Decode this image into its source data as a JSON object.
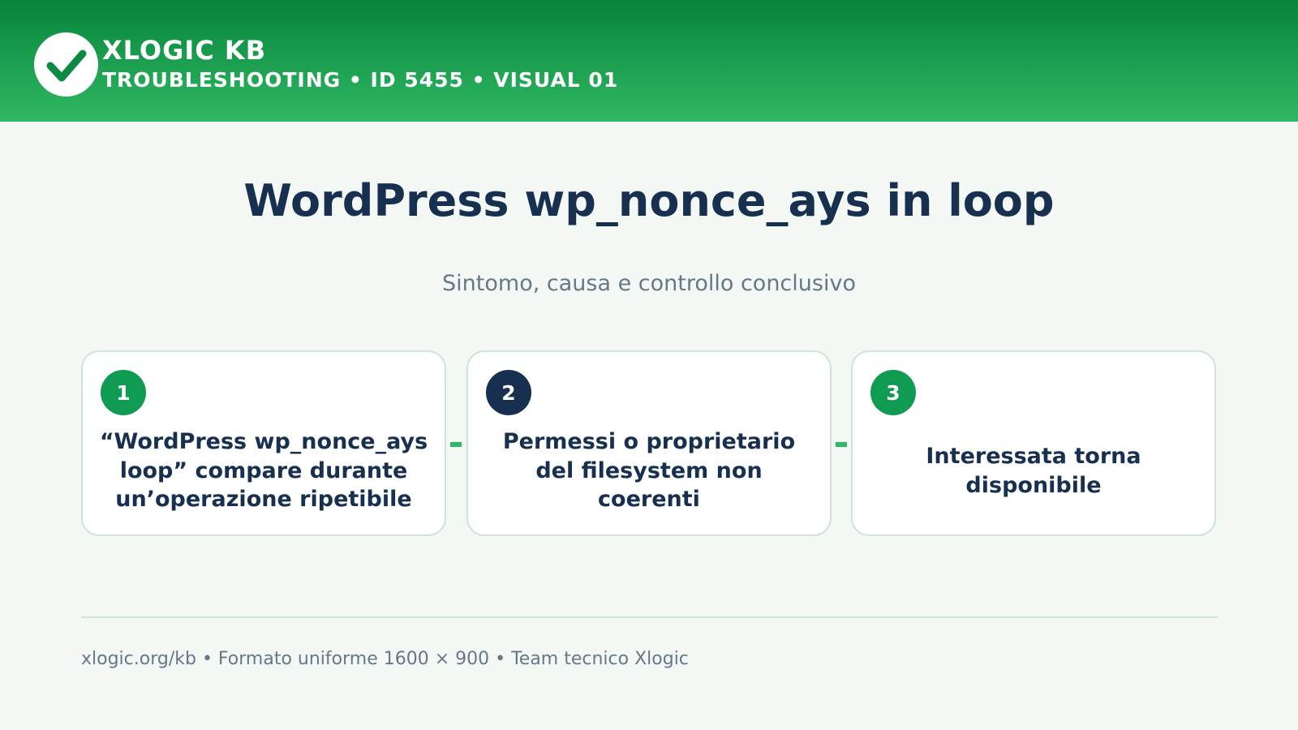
{
  "header": {
    "brand": "XLOGIC KB",
    "subtitle": "TROUBLESHOOTING • ID 5455 • VISUAL 01",
    "logo_icon": "check-icon"
  },
  "main": {
    "title": "WordPress wp_nonce_ays in loop",
    "subtitle": "Sintomo, causa e controllo conclusivo"
  },
  "steps": [
    {
      "number": "1",
      "text": "“WordPress wp_nonce_ays loop” compare durante un’operazione ripetibile",
      "badge_color": "#0f9b51"
    },
    {
      "number": "2",
      "text": "Permessi o proprietario del filesystem non coerenti",
      "badge_color": "#17304f"
    },
    {
      "number": "3",
      "text": "Interessata torna disponibile",
      "badge_color": "#0f9b51"
    }
  ],
  "footer": {
    "text": "xlogic.org/kb • Formato uniforme 1600 × 900 • Team tecnico Xlogic"
  },
  "colors": {
    "accent": "#0f9b51",
    "header_top": "#07843b",
    "header_bottom": "#2fb863",
    "navy": "#17304f"
  }
}
